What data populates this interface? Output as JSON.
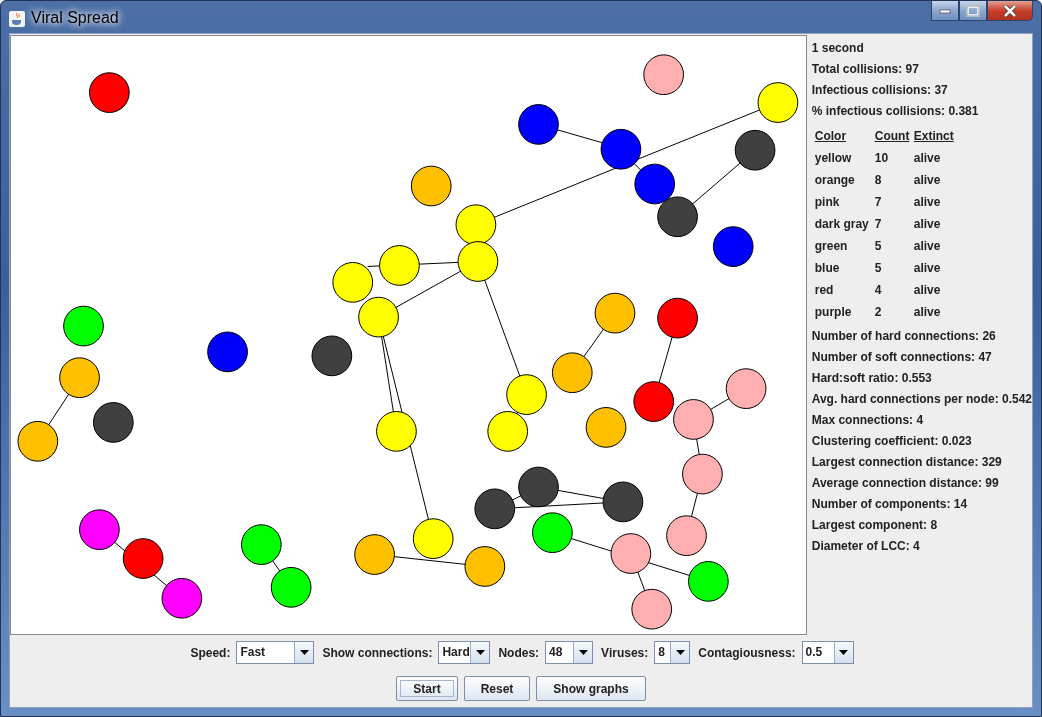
{
  "window": {
    "title": "Viral Spread"
  },
  "stats_top": [
    "1 second",
    "Total collisions: 97",
    "Infectious collisions: 37",
    "% infectious collisions: 0.381"
  ],
  "table": {
    "columns": [
      "Color",
      "Count",
      "Extinct"
    ],
    "rows": [
      [
        "yellow",
        "10",
        "alive"
      ],
      [
        "orange",
        "8",
        "alive"
      ],
      [
        "pink",
        "7",
        "alive"
      ],
      [
        "dark gray",
        "7",
        "alive"
      ],
      [
        "green",
        "5",
        "alive"
      ],
      [
        "blue",
        "5",
        "alive"
      ],
      [
        "red",
        "4",
        "alive"
      ],
      [
        "purple",
        "2",
        "alive"
      ]
    ]
  },
  "stats_bottom": [
    "Number of hard connections: 26",
    "Number of soft connections: 47",
    "Hard:soft ratio: 0.553",
    "Avg. hard connections per node: 0.542",
    "Max connections: 4",
    "Clustering coefficient: 0.023",
    "Largest connection distance: 329",
    "Average connection distance: 99",
    "Number of components: 14",
    "Largest component: 8",
    "Diameter of LCC: 4"
  ],
  "controls": [
    {
      "label": "Speed:",
      "value": "Fast"
    },
    {
      "label": "Show connections:",
      "value": "Hard"
    },
    {
      "label": "Nodes:",
      "value": "48"
    },
    {
      "label": "Viruses:",
      "value": "8"
    },
    {
      "label": "Contagiousness:",
      "value": "0.5"
    }
  ],
  "buttons": [
    {
      "label": "Start",
      "focused": true
    },
    {
      "label": "Reset",
      "focused": false
    },
    {
      "label": "Show graphs",
      "focused": false
    }
  ]
}
